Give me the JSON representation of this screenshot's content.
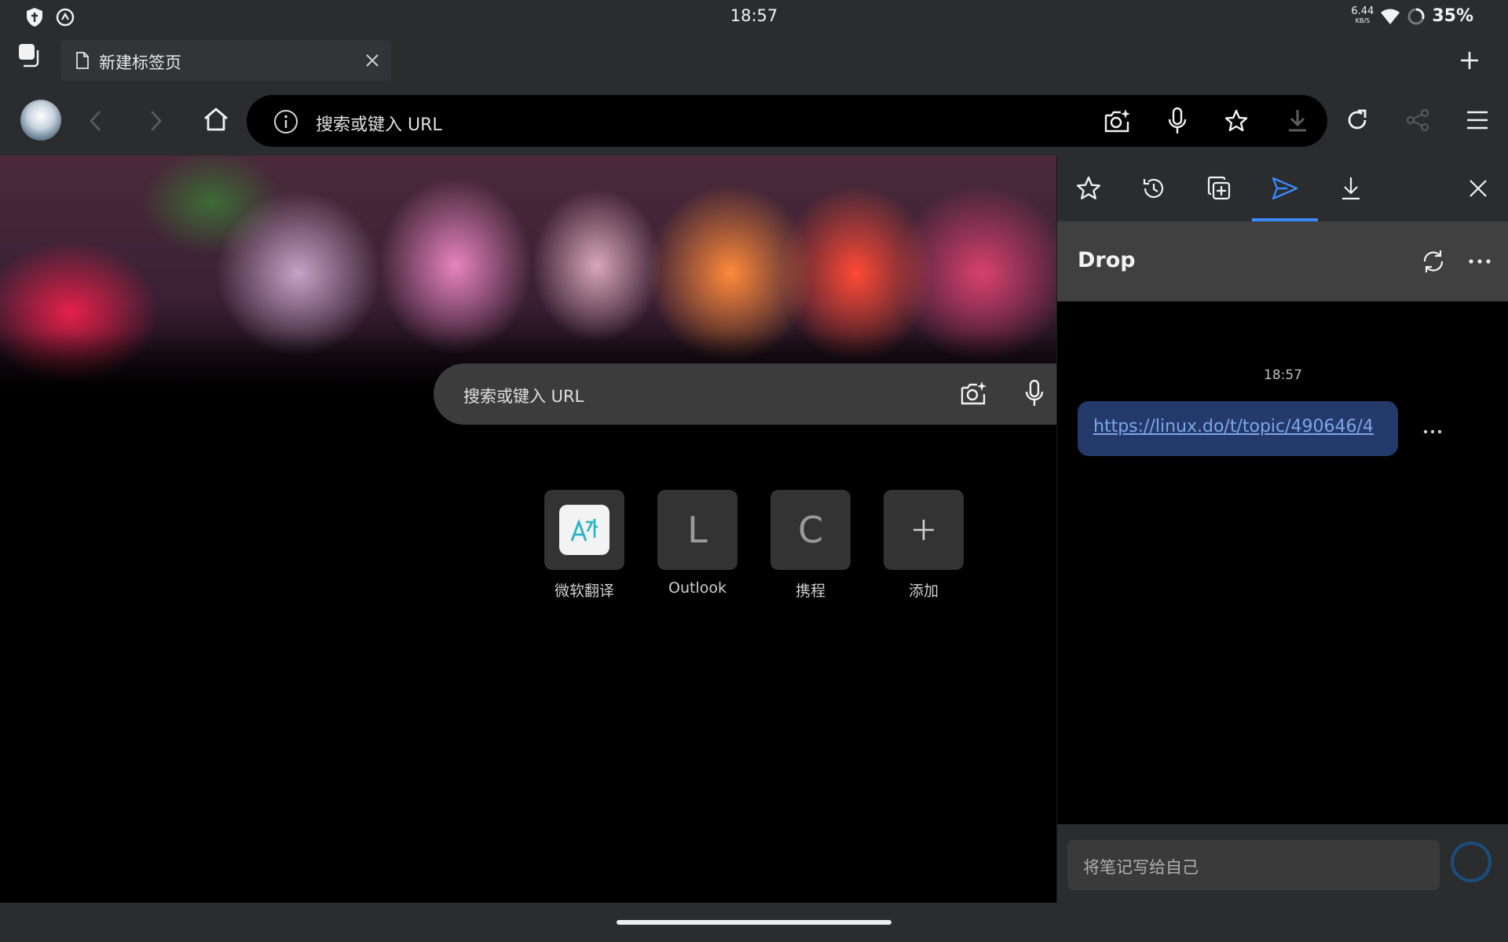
{
  "status_bar": {
    "time": "18:57",
    "net_speed": "6.44",
    "net_unit": "KB/S",
    "battery": "35%",
    "icons": [
      "shield-icon",
      "sync-icon",
      "wifi-icon",
      "battery-icon"
    ]
  },
  "tab": {
    "title": "新建标签页"
  },
  "toolbar": {
    "omnibox_placeholder": "搜索或键入 URL",
    "icons": [
      "avatar",
      "back-icon",
      "forward-icon",
      "home-icon",
      "info-icon",
      "visual-search-icon",
      "microphone-icon",
      "star-icon",
      "download-icon",
      "refresh-icon",
      "share-icon",
      "menu-icon"
    ]
  },
  "ntp": {
    "search_placeholder": "搜索或键入 URL",
    "tiles": [
      {
        "label": "微软翻译",
        "icon": "translator-icon"
      },
      {
        "label": "Outlook",
        "letter": "L"
      },
      {
        "label": "携程",
        "letter": "C"
      },
      {
        "label": "添加",
        "icon": "plus-icon"
      }
    ]
  },
  "panel": {
    "tabs": [
      "favorites-icon",
      "history-icon",
      "collections-icon",
      "drop-icon",
      "downloads-icon"
    ],
    "active_tab": "drop-icon",
    "title": "Drop",
    "message_time": "18:57",
    "message_link": "https://linux.do/t/topic/490646/4",
    "compose_placeholder": "将笔记写给自己",
    "accent_color": "#3b88ff"
  }
}
